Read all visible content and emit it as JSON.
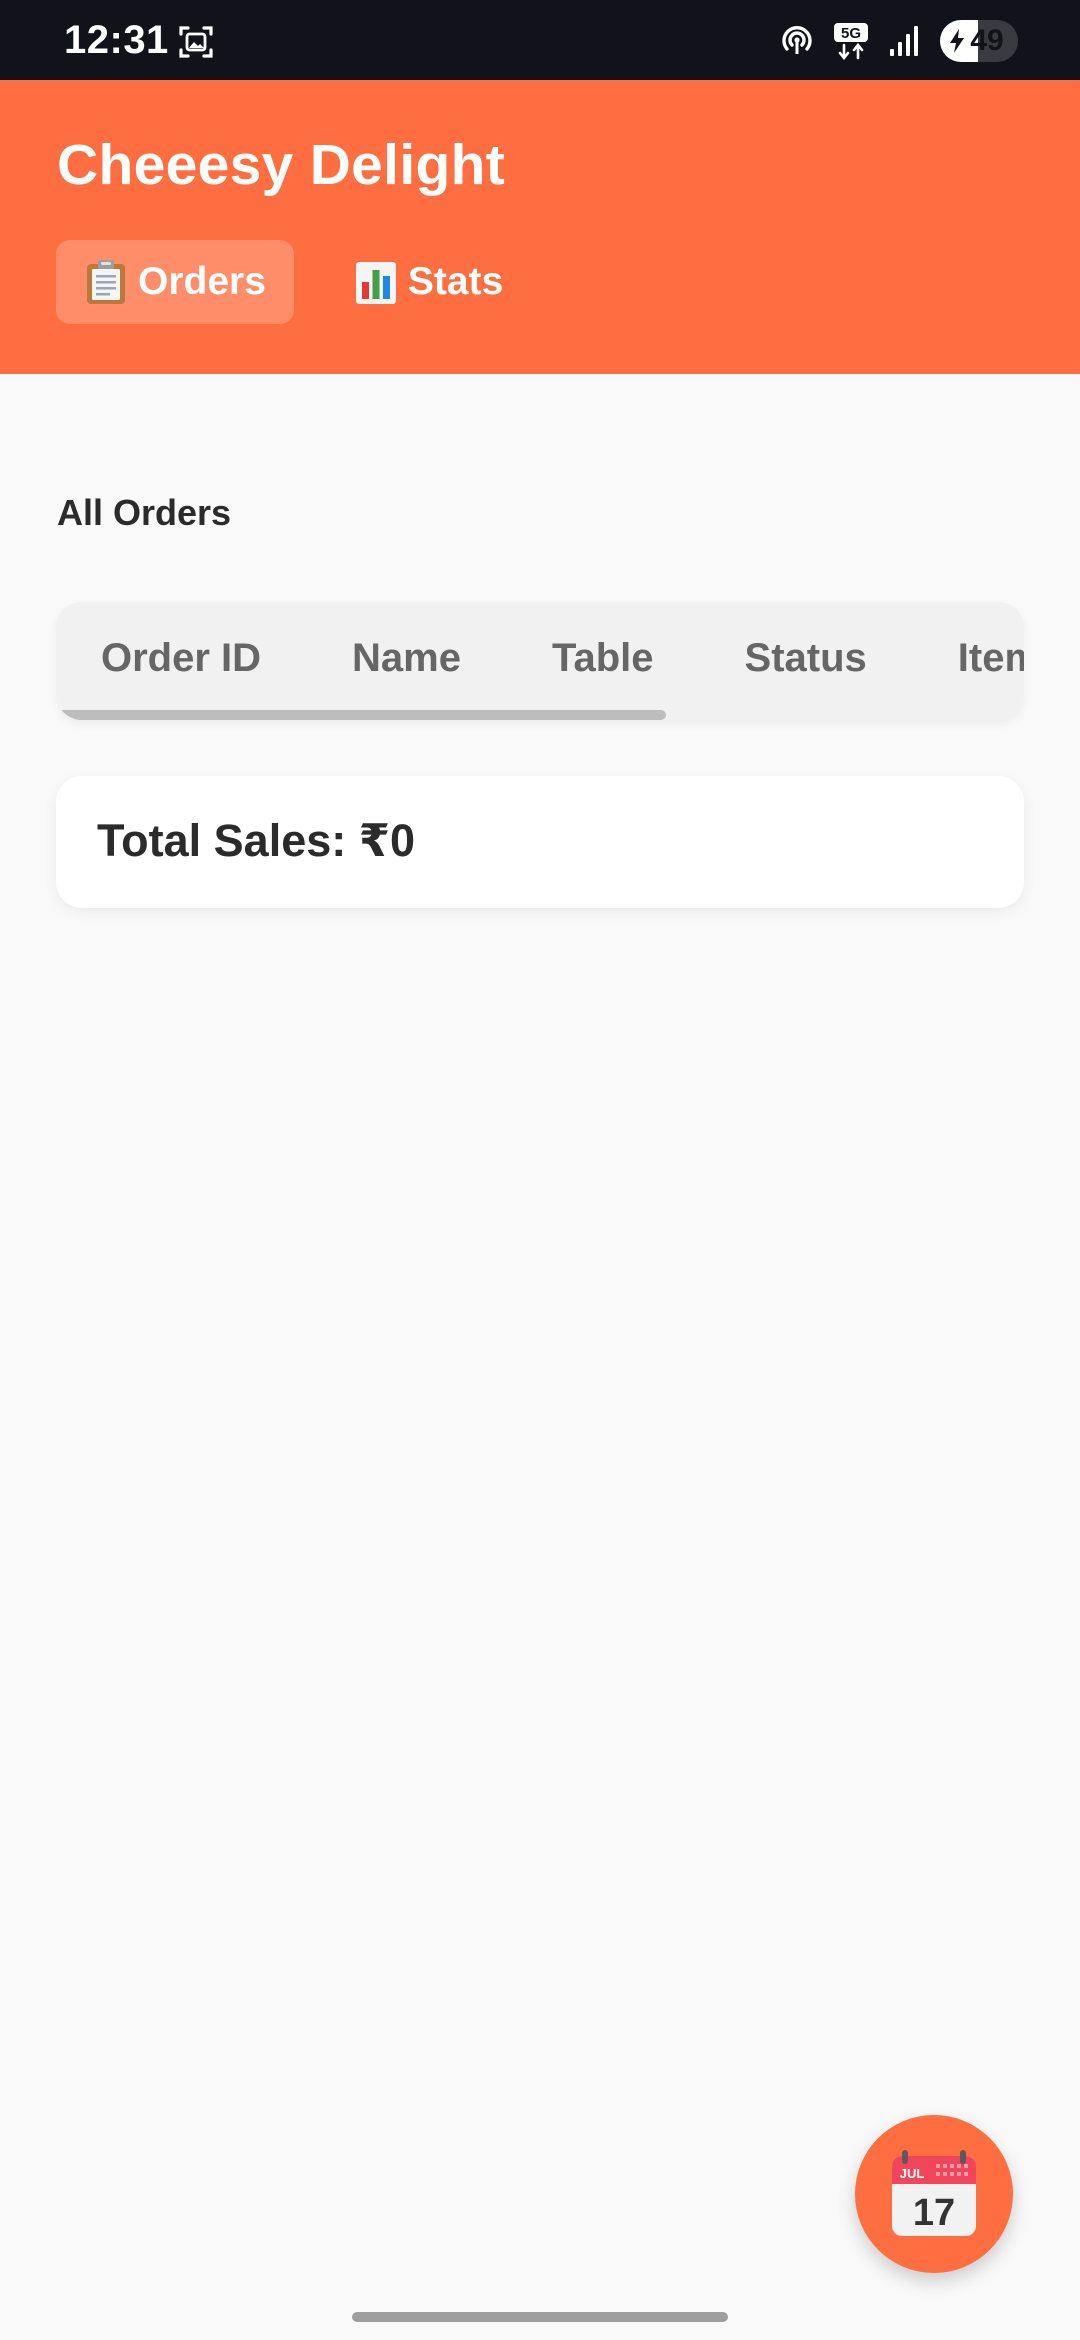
{
  "status_bar": {
    "time": "12:31",
    "network_label": "5G",
    "battery_level": "49",
    "battery_fraction": 0.49,
    "icons": [
      "screenshot-icon",
      "hotspot-icon",
      "network-5g-icon",
      "signal-icon",
      "battery-icon"
    ]
  },
  "header": {
    "title": "Cheeesy Delight",
    "background_color": "#ff6e40",
    "tabs": [
      {
        "label": "Orders",
        "icon": "clipboard-icon",
        "active": true
      },
      {
        "label": "Stats",
        "icon": "bar-chart-icon",
        "active": false
      }
    ]
  },
  "main": {
    "section_title": "All Orders",
    "table": {
      "columns": [
        "Order ID",
        "Name",
        "Table",
        "Status",
        "Items"
      ]
    },
    "summary": {
      "total_sales": "Total Sales: ₹0"
    }
  },
  "fab": {
    "icon": "calendar-icon",
    "calendar_month": "JUL",
    "calendar_day": "17"
  }
}
